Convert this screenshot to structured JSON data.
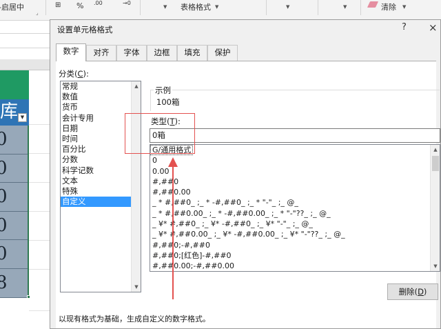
{
  "ribbon": {
    "left_fragment": "-启居中",
    "percent_symbol": "%",
    "decimal_increase": ".00",
    "decimal_decrease": "→0",
    "table_format": "表格格式",
    "clear": "清除"
  },
  "sheet": {
    "header_char": "库",
    "cells": [
      "0",
      "0",
      "0",
      "0",
      "0",
      "8"
    ]
  },
  "dialog": {
    "title": "设置单元格格式",
    "help": "?",
    "close": "×",
    "tabs": [
      {
        "label": "数字"
      },
      {
        "label": "对齐"
      },
      {
        "label": "字体"
      },
      {
        "label": "边框"
      },
      {
        "label": "填充"
      },
      {
        "label": "保护"
      }
    ],
    "category_label": "分类(",
    "category_key": "C",
    "category_label_end": "):",
    "categories": [
      {
        "label": "常规"
      },
      {
        "label": "数值"
      },
      {
        "label": "货币"
      },
      {
        "label": "会计专用"
      },
      {
        "label": "日期"
      },
      {
        "label": "时间"
      },
      {
        "label": "百分比"
      },
      {
        "label": "分数"
      },
      {
        "label": "科学记数"
      },
      {
        "label": "文本"
      },
      {
        "label": "特殊"
      },
      {
        "label": "自定义"
      }
    ],
    "sample_label": "示例",
    "sample_value": "100箱",
    "type_label": "类型(",
    "type_key": "T",
    "type_label_end": "):",
    "type_value": "0箱",
    "formats": [
      {
        "label": "G/通用格式"
      },
      {
        "label": "0"
      },
      {
        "label": "0.00"
      },
      {
        "label": "#,##0"
      },
      {
        "label": "#,##0.00"
      },
      {
        "label": "_ * #,##0_ ;_ * -#,##0_ ;_ * \"-\"_ ;_ @_"
      },
      {
        "label": "_ * #,##0.00_ ;_ * -#,##0.00_ ;_ * \"-\"??_ ;_ @_"
      },
      {
        "label": "_ ¥* #,##0_ ;_ ¥* -#,##0_ ;_ ¥* \"-\"_ ;_ @_"
      },
      {
        "label": "_ ¥* #,##0.00_ ;_ ¥* -#,##0.00_ ;_ ¥* \"-\"??_ ;_ @_"
      },
      {
        "label": "#,##0;-#,##0"
      },
      {
        "label": "#,##0;[红色]-#,##0"
      },
      {
        "label": "#,##0.00;-#,##0.00"
      }
    ],
    "delete_button": "删除(",
    "delete_key": "D",
    "delete_button_end": ")",
    "hint": "以现有格式为基础，生成自定义的数字格式。"
  },
  "colors": {
    "selection": "#3399ff",
    "annotation_red": "#e3514f",
    "sheet_green": "#1f9a63",
    "sheet_blue": "#2e74b5"
  }
}
